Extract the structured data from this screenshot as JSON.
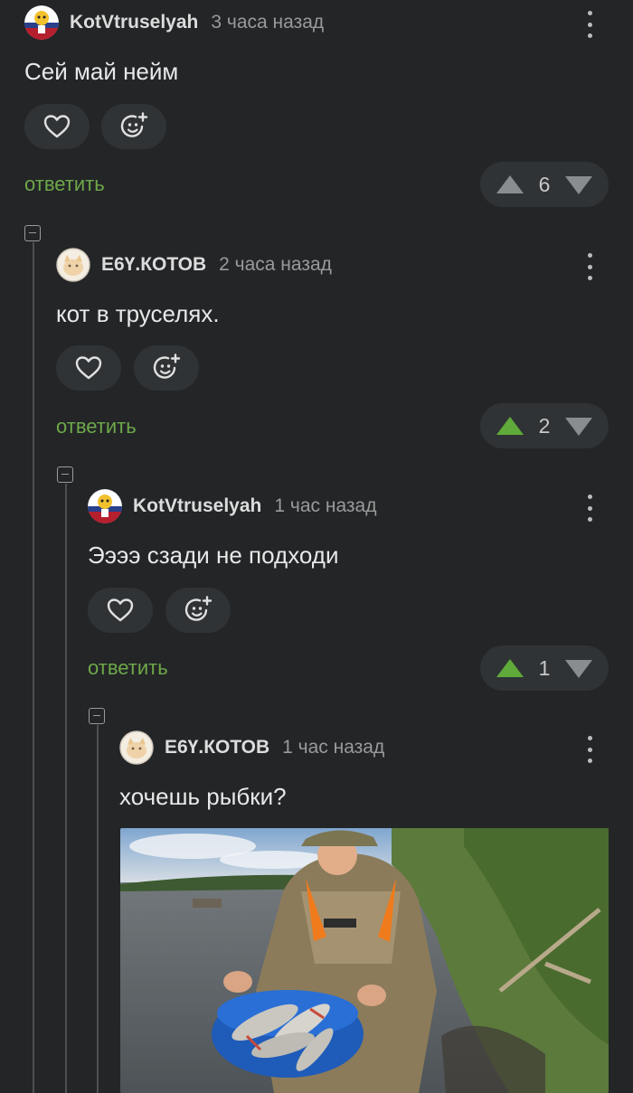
{
  "comments": [
    {
      "username": "KotVtruselyah",
      "time": "3 часа назад",
      "text": "Сей май нейм",
      "reply_label": "ответить",
      "rating": "6",
      "vote_state": "none"
    },
    {
      "username": "Е6Ү.КОТОВ",
      "time": "2 часа назад",
      "text": "кот в труселях.",
      "reply_label": "ответить",
      "rating": "2",
      "vote_state": "up"
    },
    {
      "username": "KotVtruselyah",
      "time": "1 час назад",
      "text": "Ээээ сзади не подходи",
      "reply_label": "ответить",
      "rating": "1",
      "vote_state": "up"
    },
    {
      "username": "Е6Ү.КОТОВ",
      "time": "1 час назад",
      "text": "хочешь рыбки?"
    }
  ],
  "colors": {
    "background": "#232527",
    "accent_green": "#6ea84a",
    "upvote_active": "#5faa3a",
    "vote_inactive": "#8a8d90"
  },
  "icons": [
    "heart-icon",
    "add-emoji-icon",
    "more-vertical-icon",
    "upvote-icon",
    "downvote-icon",
    "collapse-icon"
  ]
}
